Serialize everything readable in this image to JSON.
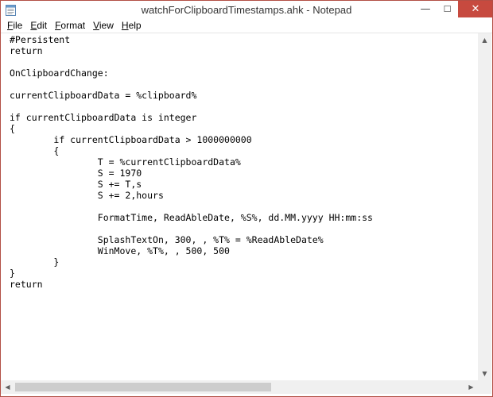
{
  "window": {
    "title": "watchForClipboardTimestamps.ahk - Notepad"
  },
  "controls": {
    "minimize": "—",
    "maximize": "☐",
    "close": "✕"
  },
  "menu": {
    "items": [
      {
        "mnemonic": "F",
        "rest": "ile"
      },
      {
        "mnemonic": "E",
        "rest": "dit"
      },
      {
        "mnemonic": "F",
        "rest": "ormat"
      },
      {
        "mnemonic": "V",
        "rest": "iew"
      },
      {
        "mnemonic": "H",
        "rest": "elp"
      }
    ]
  },
  "editor": {
    "content": "#Persistent\nreturn\n\nOnClipboardChange:\n\ncurrentClipboardData = %clipboard%\n\nif currentClipboardData is integer\n{\n\tif currentClipboardData > 1000000000\n\t{\n\t\tT = %currentClipboardData%\n\t\tS = 1970\n\t\tS += T,s\n\t\tS += 2,hours\n\n\t\tFormatTime, ReadAbleDate, %S%, dd.MM.yyyy HH:mm:ss\n\n\t\tSplashTextOn, 300, , %T% = %ReadAbleDate%\n\t\tWinMove, %T%, , 500, 500\n\t}\n}\nreturn"
  },
  "icons": {
    "app": "notepad-icon",
    "scroll_up": "▲",
    "scroll_down": "▼",
    "scroll_left": "◀",
    "scroll_right": "▶"
  },
  "colors": {
    "window_border": "#b24f45",
    "close_button": "#c74a3f"
  }
}
